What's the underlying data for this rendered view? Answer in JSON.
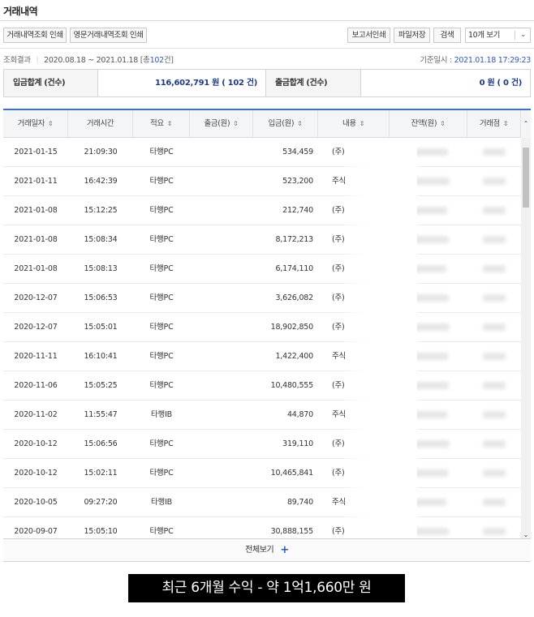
{
  "page": {
    "title": "거래내역"
  },
  "toolbar": {
    "print_history": "거래내역조회 인쇄",
    "print_english": "영문거래내역조회 인쇄",
    "print_report": "보고서인쇄",
    "save_file": "파일저장",
    "search": "검색",
    "page_size_selected": "10개 보기"
  },
  "result": {
    "label": "조회결과",
    "period": "2020.08.18 ~ 2021.01.18",
    "count_prefix": "[총",
    "count_value": "102",
    "count_suffix": "건]",
    "base_label": "기준일시 :",
    "base_value": "2021.01.18 17:29:23"
  },
  "summary": {
    "deposit_label": "입금합계 (건수)",
    "deposit_value": "116,602,791 원 ( 102 건)",
    "withdraw_label": "출금합계 (건수)",
    "withdraw_value": "0 원 ( 0 건)"
  },
  "table": {
    "columns": [
      "거래일자",
      "거래시간",
      "적요",
      "출금(원)",
      "입금(원)",
      "내용",
      "잔액(원)",
      "거래점"
    ],
    "sort_icon": "sort-arrows-icon",
    "rows": [
      {
        "date": "2021-01-15",
        "time": "21:09:30",
        "type": "타행PC",
        "out": "",
        "in": "534,459",
        "memo": "(주)"
      },
      {
        "date": "2021-01-11",
        "time": "16:42:39",
        "type": "타행PC",
        "out": "",
        "in": "523,200",
        "memo": "주식"
      },
      {
        "date": "2021-01-08",
        "time": "15:12:25",
        "type": "타행PC",
        "out": "",
        "in": "212,740",
        "memo": "(주)"
      },
      {
        "date": "2021-01-08",
        "time": "15:08:34",
        "type": "타행PC",
        "out": "",
        "in": "8,172,213",
        "memo": "(주)"
      },
      {
        "date": "2021-01-08",
        "time": "15:08:13",
        "type": "타행PC",
        "out": "",
        "in": "6,174,110",
        "memo": "(주)"
      },
      {
        "date": "2020-12-07",
        "time": "15:06:53",
        "type": "타행PC",
        "out": "",
        "in": "3,626,082",
        "memo": "(주)"
      },
      {
        "date": "2020-12-07",
        "time": "15:05:01",
        "type": "타행PC",
        "out": "",
        "in": "18,902,850",
        "memo": "(주)"
      },
      {
        "date": "2020-11-11",
        "time": "16:10:41",
        "type": "타행PC",
        "out": "",
        "in": "1,422,400",
        "memo": "주식"
      },
      {
        "date": "2020-11-06",
        "time": "15:05:25",
        "type": "타행PC",
        "out": "",
        "in": "10,480,555",
        "memo": "(주)"
      },
      {
        "date": "2020-11-02",
        "time": "11:55:47",
        "type": "타행IB",
        "out": "",
        "in": "44,870",
        "memo": "주식"
      },
      {
        "date": "2020-10-12",
        "time": "15:06:56",
        "type": "타행PC",
        "out": "",
        "in": "319,110",
        "memo": "(주)"
      },
      {
        "date": "2020-10-12",
        "time": "15:02:11",
        "type": "타행PC",
        "out": "",
        "in": "10,465,841",
        "memo": "(주)"
      },
      {
        "date": "2020-10-05",
        "time": "09:27:20",
        "type": "타행IB",
        "out": "",
        "in": "89,740",
        "memo": "주식"
      },
      {
        "date": "2020-09-07",
        "time": "15:05:10",
        "type": "타행PC",
        "out": "",
        "in": "30,888,155",
        "memo": "(주)"
      }
    ]
  },
  "more": {
    "label": "전체보기",
    "icon": "plus-icon"
  },
  "caption": {
    "text": "최근 6개월 수익 - 약 1억1,660만 원"
  },
  "colors": {
    "accent": "#2d58c9",
    "header_border": "#3a73cc",
    "caption_bg": "#000000"
  }
}
